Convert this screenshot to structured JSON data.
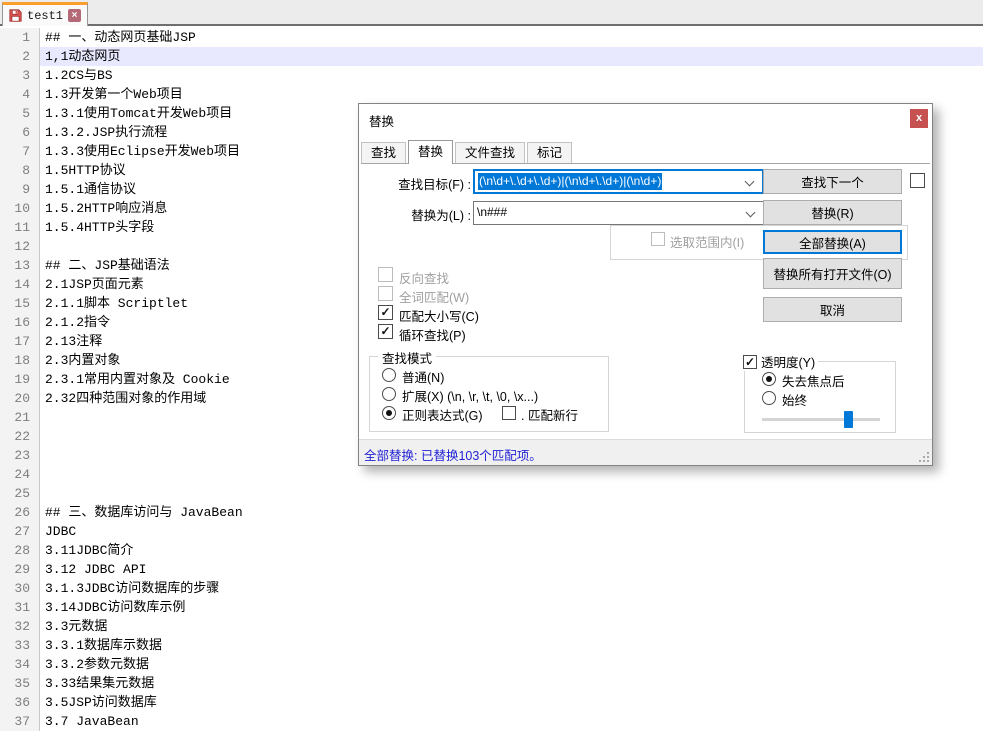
{
  "colors": {
    "accent": "#0078d7",
    "tab_accent_stripe": "#fa9e2d",
    "dialog_close_bg": "#c75050",
    "current_line_bg": "#e8e8ff",
    "status_text": "#2222d6",
    "selected_text_bg": "#0078d7"
  },
  "tab_bar": {
    "tabs": [
      {
        "label": "test1",
        "modified": true,
        "close_glyph": "×"
      }
    ]
  },
  "editor": {
    "current_line": 2,
    "lines": [
      "## 一、动态网页基础JSP",
      "1,1动态网页",
      "1.2CS与BS",
      "1.3开发第一个Web项目",
      "1.3.1使用Tomcat开发Web项目",
      "1.3.2.JSP执行流程",
      "1.3.3使用Eclipse开发Web项目",
      "1.5HTTP协议",
      "1.5.1通信协议",
      "1.5.2HTTP响应消息",
      "1.5.4HTTP头字段",
      "",
      "## 二、JSP基础语法",
      "2.1JSP页面元素",
      "2.1.1脚本 Scriptlet",
      "2.1.2指令",
      "2.13注释",
      "2.3内置对象",
      "2.3.1常用内置对象及 Cookie",
      "2.32四种范围对象的作用域",
      "",
      "",
      "",
      "",
      "",
      "## 三、数据库访问与 JavaBean",
      "JDBC",
      "3.11JDBC简介",
      "3.12 JDBC API",
      "3.1.3JDBC访问数据库的步骤",
      "3.14JDBC访问数库示例",
      "3.3元数据",
      "3.3.1数据库示数据",
      "3.3.2参数元数据",
      "3.33结果集元数据",
      "3.5JSP访问数据库",
      "3.7 JavaBean"
    ]
  },
  "dialog": {
    "title": "替换",
    "close_glyph": "x",
    "tabs": [
      {
        "label": "查找"
      },
      {
        "label": "替换"
      },
      {
        "label": "文件查找"
      },
      {
        "label": "标记"
      }
    ],
    "find": {
      "label": "查找目标(F) :",
      "value": "(\\n\\d+\\.\\d+\\.\\d+)|(\\n\\d+\\.\\d+)|(\\n\\d+)"
    },
    "replace": {
      "label": "替换为(L) :",
      "value": "\\n###"
    },
    "buttons": {
      "find_next": "查找下一个",
      "replace": "替换(R)",
      "replace_all": "全部替换(A)",
      "replace_all_open": "替换所有打开文件(O)",
      "cancel": "取消"
    },
    "options": {
      "in_selection": "选取范围内(I)",
      "backward": "反向查找",
      "whole_word": "全词匹配(W)",
      "match_case": "匹配大小写(C)",
      "wrap_around": "循环查找(P)",
      "check_glyph": "✓"
    },
    "search_mode": {
      "title": "查找模式",
      "normal": "普通(N)",
      "extended": "扩展(X) (\\n, \\r, \\t, \\0, \\x...)",
      "regex": "正则表达式(G)",
      "dot_matches_newline": ". 匹配新行"
    },
    "transparency": {
      "title": "透明度(Y)",
      "on_lose_focus": "失去焦点后",
      "always": "始终",
      "slider_percent": 70
    },
    "status": "全部替换: 已替换103个匹配项。"
  }
}
